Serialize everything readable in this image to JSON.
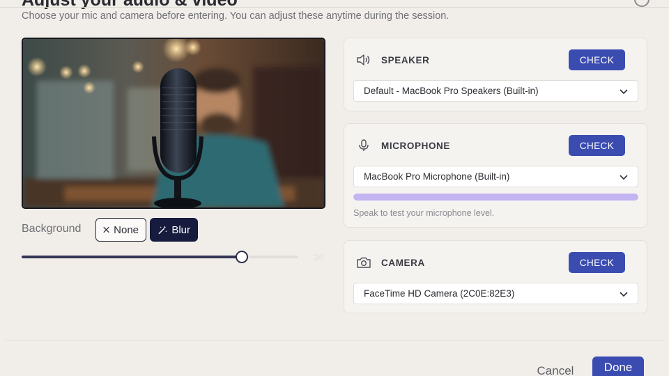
{
  "header": {
    "title": "Adjust your audio & video",
    "subtitle": "Choose your mic and camera before entering. You can adjust these anytime during the session."
  },
  "preview": {
    "image": "video-preview-microphone-person"
  },
  "background": {
    "label": "Background",
    "options": [
      {
        "label": "None",
        "icon": "close-icon",
        "selected": false
      },
      {
        "label": "Blur",
        "icon": "magic-wand-icon",
        "selected": true
      }
    ],
    "blur_slider": {
      "value": 36,
      "min": 0,
      "max": 40,
      "value_label": "36"
    }
  },
  "devices": {
    "speaker": {
      "icon": "speaker-icon",
      "label": "SPEAKER",
      "check_label": "CHECK",
      "selected": "Default - MacBook Pro Speakers (Built-in)"
    },
    "microphone": {
      "icon": "microphone-icon",
      "label": "MICROPHONE",
      "check_label": "CHECK",
      "selected": "MacBook Pro Microphone (Built-in)",
      "level": 1.0,
      "hint": "Speak to test your microphone level."
    },
    "camera": {
      "icon": "camera-icon",
      "label": "CAMERA",
      "check_label": "CHECK",
      "selected": "FaceTime HD Camera (2C0E:82E3)"
    }
  },
  "footer": {
    "cancel_label": "Cancel",
    "done_label": "Done"
  },
  "colors": {
    "accent": "#3b4cb0",
    "chip_selected": "#171c3f",
    "mic_level": "#c4b4f2",
    "background": "#f1eeea"
  }
}
